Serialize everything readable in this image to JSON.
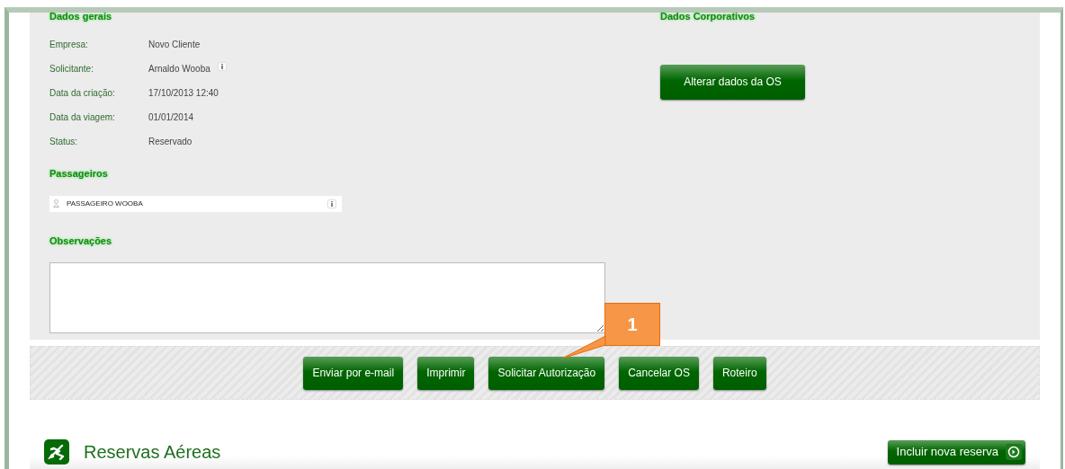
{
  "general": {
    "title": "Dados gerais",
    "fields": [
      {
        "label": "Empresa:",
        "value": "Novo Cliente",
        "info": false
      },
      {
        "label": "Solicitante:",
        "value": "Arnaldo Wooba",
        "info": true
      },
      {
        "label": "Data da criação:",
        "value": "17/10/2013 12:40",
        "info": false
      },
      {
        "label": "Data da viagem:",
        "value": "01/01/2014",
        "info": false
      },
      {
        "label": "Status:",
        "value": "Reservado",
        "info": false
      }
    ]
  },
  "passengers": {
    "title": "Passageiros",
    "items": [
      {
        "name": "PASSAGEIRO WOOBA",
        "info": true
      }
    ]
  },
  "notes": {
    "title": "Observações"
  },
  "corporate": {
    "title": "Dados Corporativos",
    "button": "Alterar dados da OS"
  },
  "actions": [
    "Enviar por e-mail",
    "Imprimir",
    "Solicitar Autorização",
    "Cancelar OS",
    "Roteiro"
  ],
  "callout": {
    "label": "1"
  },
  "air": {
    "title": "Reservas Aéreas",
    "button": "Incluir nova reserva"
  }
}
